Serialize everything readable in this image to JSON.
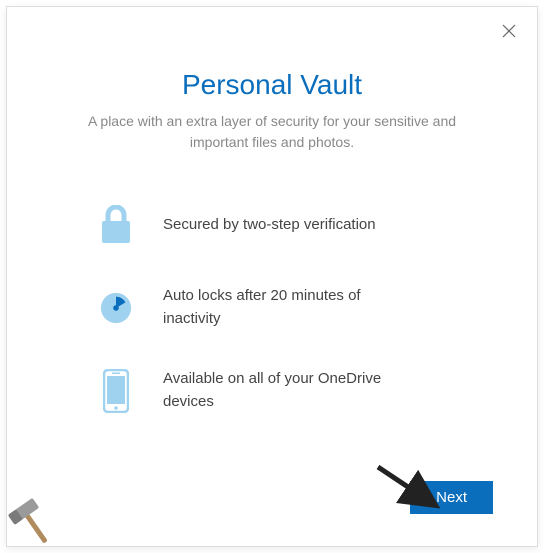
{
  "dialog": {
    "title": "Personal Vault",
    "subtitle": "A place with an extra layer of security for your sensitive and important files and photos."
  },
  "features": [
    {
      "icon": "lock-icon",
      "text": "Secured by two-step verification"
    },
    {
      "icon": "clock-icon",
      "text": "Auto locks after 20 minutes of inactivity"
    },
    {
      "icon": "phone-icon",
      "text": "Available on all of your OneDrive devices"
    }
  ],
  "buttons": {
    "next": "Next"
  }
}
